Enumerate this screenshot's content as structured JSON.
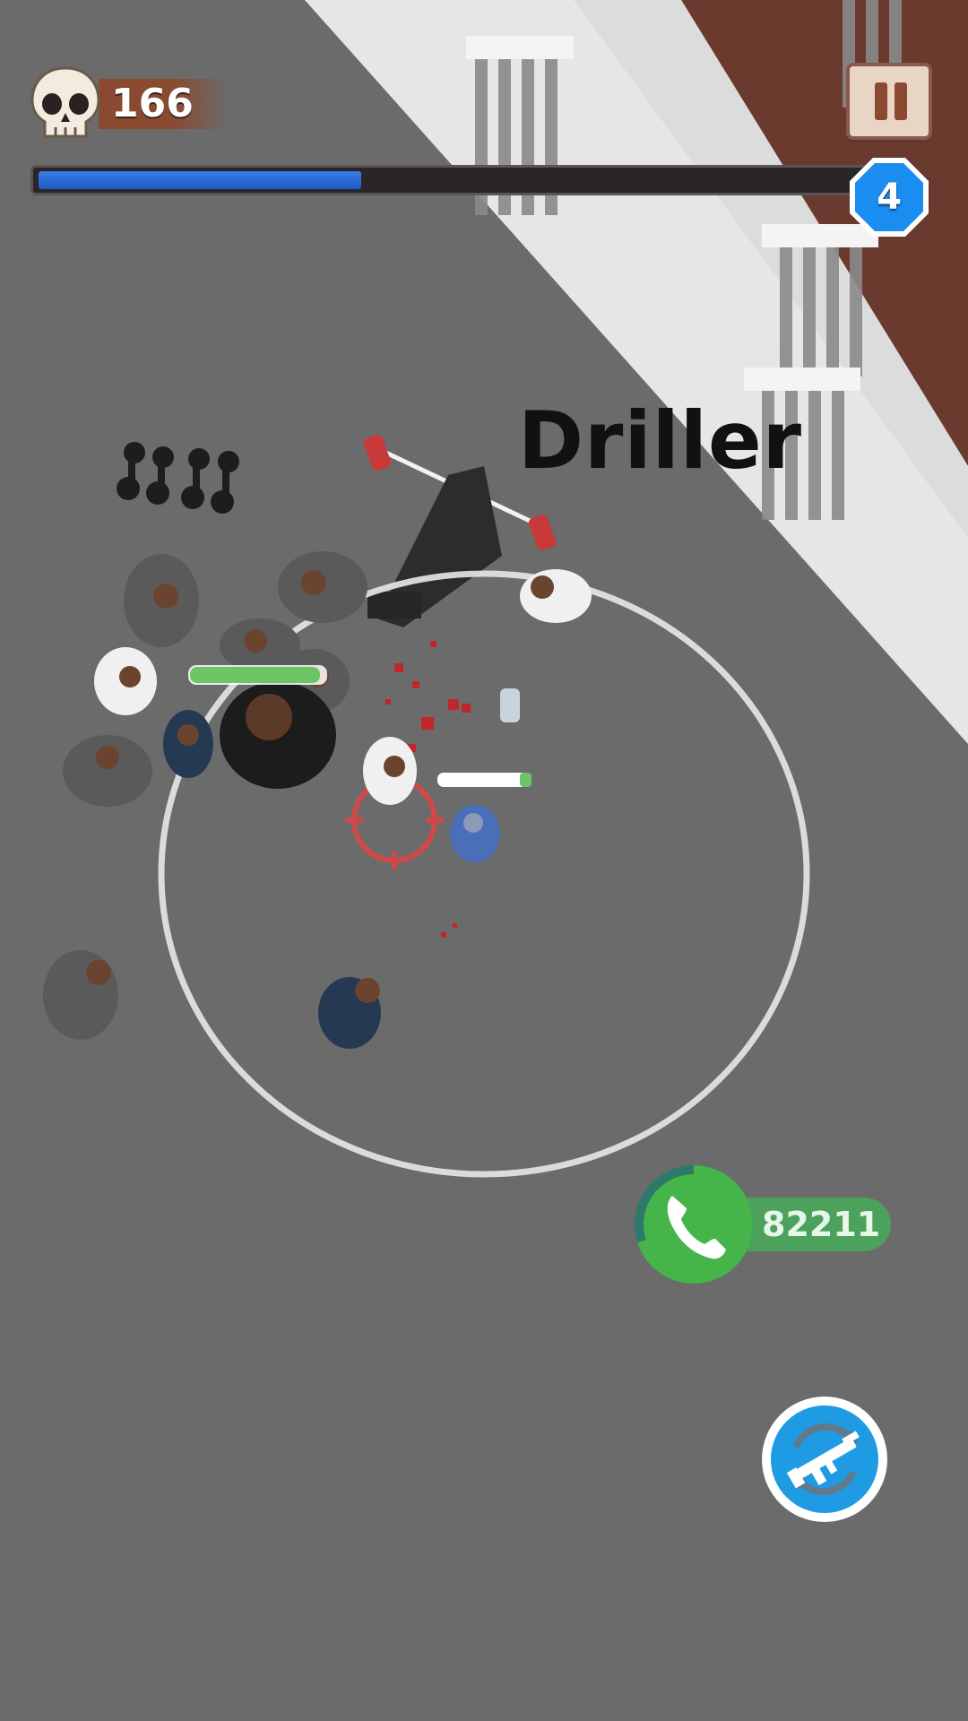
{
  "hud": {
    "kill_count": "166",
    "level": "4",
    "level_progress": 0.39,
    "pause_icon": "pause-icon",
    "skull_icon": "skull-icon"
  },
  "enemy": {
    "name": "Driller"
  },
  "phone": {
    "cash": "82211",
    "icon": "phone-icon",
    "cooldown": 0.7
  },
  "weapon": {
    "icon": "rifle-swap-icon"
  },
  "colors": {
    "progress_fill": "#2a6ad6",
    "level_badge": "#1a8df0",
    "phone_green": "#45b549",
    "swap_blue": "#1f9be3"
  }
}
